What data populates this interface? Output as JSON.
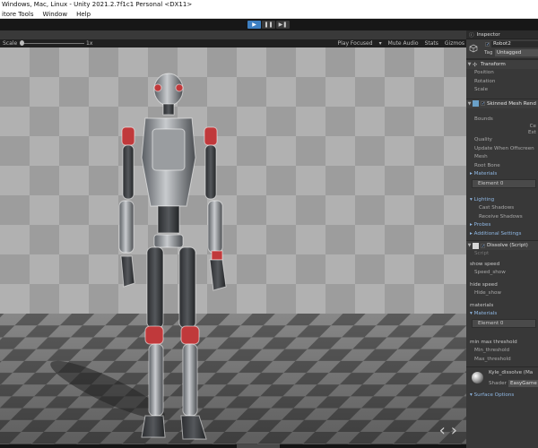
{
  "window": {
    "title": "Windows, Mac, Linux - Unity 2021.2.7f1c1 Personal <DX11>"
  },
  "menu": {
    "items": [
      {
        "label": "itore Tools"
      },
      {
        "label": "Window"
      },
      {
        "label": "Help"
      }
    ]
  },
  "toolbar": {
    "play_icon": "play-icon",
    "pause_icon": "pause-icon",
    "step_icon": "step-icon",
    "play_glyph": "▶",
    "pause_glyph": "❚❚",
    "step_glyph": "▶❚"
  },
  "game_view": {
    "scale_label": "Scale",
    "scale_value": "1x",
    "play_focused": "Play Focused",
    "mute_audio": "Mute Audio",
    "stats": "Stats",
    "gizmos": "Gizmos",
    "prev_arrow": "‹",
    "next_arrow": "›",
    "colors": {
      "light_tile": "#b1b1b1",
      "dark_tile": "#9d9d9d",
      "floor_light": "#8f8f8f",
      "floor_dark": "#5e5e5e",
      "accent_red": "#c0393b"
    }
  },
  "inspector": {
    "tab_label": "Inspector",
    "object_name": "Robot2",
    "tag_label": "Tag",
    "tag_value": "Untagged",
    "transform": {
      "title": "Transform",
      "rows": [
        "Position",
        "Rotation",
        "Scale"
      ]
    },
    "skinned_mesh": {
      "title": "Skinned Mesh Rend",
      "bounds_label": "Bounds",
      "bounds_c": "Ce",
      "bounds_e": "Ext",
      "quality": "Quality",
      "update_offscreen": "Update When Offscreen",
      "mesh": "Mesh",
      "root_bone": "Root Bone",
      "materials": "Materials",
      "element": "Element 0",
      "lighting": "Lighting",
      "cast_shadows": "Cast Shadows",
      "receive_shadows": "Receive Shadows",
      "probes": "Probes",
      "additional_settings": "Additional Settings"
    },
    "dissolve": {
      "title": "Dissolve (Script)",
      "script_label": "Script",
      "show_speed_header": "show speed",
      "show_speed_field": "Speed_show",
      "hide_speed_header": "hide speed",
      "hide_speed_field": "Hide_show",
      "materials": "materials",
      "materials_sub": "Materials",
      "element": "Element 0",
      "min_max_header": "min max threshold",
      "min_threshold": "Min_threshold",
      "max_threshold": "Max_threshold"
    },
    "material": {
      "name": "Kyle_dissolve (Ma",
      "shader_label": "Shader",
      "shader_value": "EasyGame"
    },
    "surface_options": "Surface Options"
  }
}
